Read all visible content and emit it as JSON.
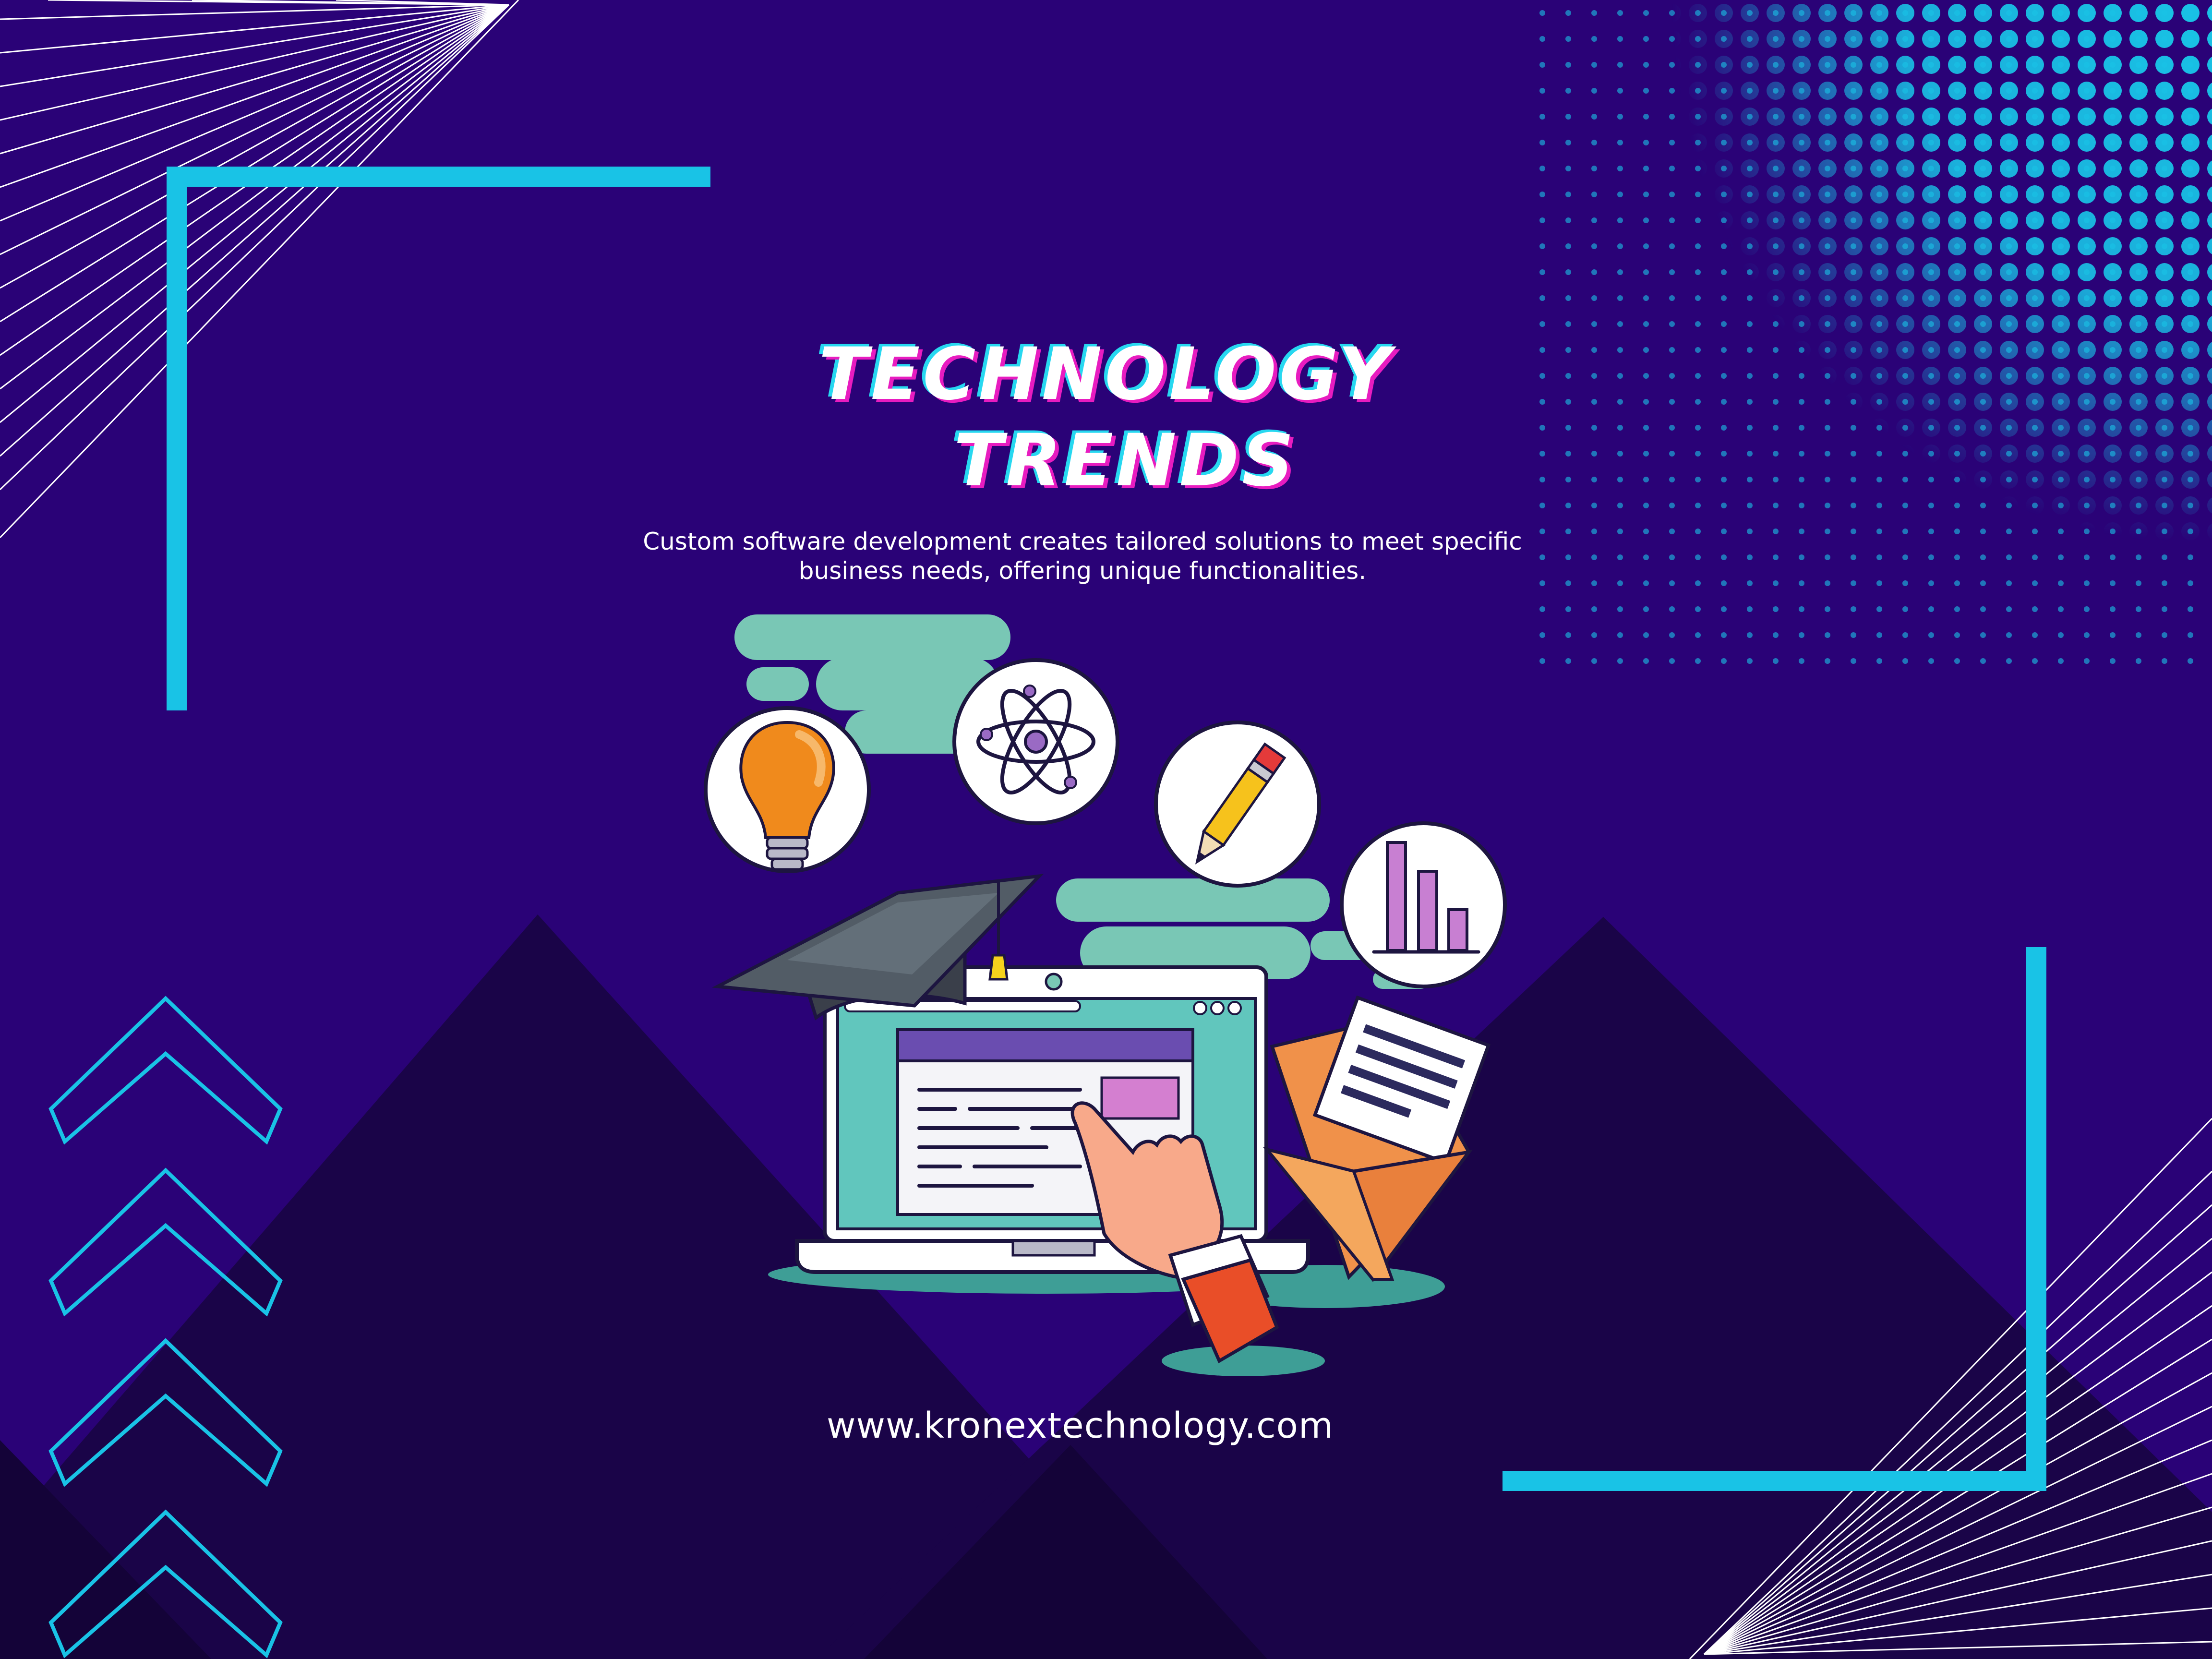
{
  "poster": {
    "title_line1": "TECHNOLOGY",
    "title_line2": "TRENDS",
    "description_line1": "Custom software development creates tailored solutions to meet specific",
    "description_line2": "business needs, offering unique functionalities.",
    "website": "www.kronextechnology.com"
  },
  "colors": {
    "background": "#2a0277",
    "mountain_dark": "#1a0448",
    "accent_cyan": "#19c3e6",
    "accent_magenta": "#e81cc0",
    "cloud_teal": "#79c7b5"
  },
  "icons": [
    "lightbulb-icon",
    "atom-icon",
    "pencil-icon",
    "bar-chart-icon",
    "graduation-cap-icon",
    "laptop-icon",
    "envelope-icon",
    "pointing-hand-icon"
  ]
}
